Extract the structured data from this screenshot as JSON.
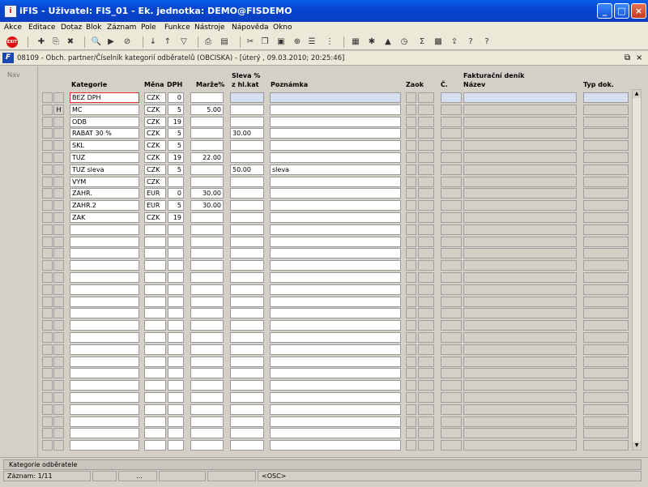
{
  "window": {
    "title": "iFIS - Uživatel: FIS_01 - Ek. jednotka: DEMO@FISDEMO",
    "app_icon_glyph": "i"
  },
  "menu": [
    "Akce",
    "Editace",
    "Dotaz",
    "Blok",
    "Záznam",
    "Pole",
    "Funkce",
    "Nástroje",
    "Nápověda",
    "Okno"
  ],
  "toolbar": {
    "exit_label": "EXIT",
    "icons": [
      {
        "name": "insert-record-icon",
        "glyph": "✚"
      },
      {
        "name": "save-record-icon",
        "glyph": "⎘"
      },
      {
        "name": "delete-record-icon",
        "glyph": "✖"
      },
      {
        "name": "enter-query-icon",
        "glyph": "🔍"
      },
      {
        "name": "execute-query-icon",
        "glyph": "▶"
      },
      {
        "name": "cancel-query-icon",
        "glyph": "⊘"
      },
      {
        "name": "sort-asc-icon",
        "glyph": "↓"
      },
      {
        "name": "sort-desc-icon",
        "glyph": "↑"
      },
      {
        "name": "filter-icon",
        "glyph": "▽"
      },
      {
        "name": "print-icon",
        "glyph": "⎙"
      },
      {
        "name": "print-preview-icon",
        "glyph": "▤"
      },
      {
        "name": "cut-icon",
        "glyph": "✂"
      },
      {
        "name": "copy-icon",
        "glyph": "❐"
      },
      {
        "name": "paste-icon",
        "glyph": "▣"
      },
      {
        "name": "zoom-icon",
        "glyph": "⊕"
      },
      {
        "name": "list-icon",
        "glyph": "☰"
      },
      {
        "name": "columns-icon",
        "glyph": "⋮"
      },
      {
        "name": "calculator-icon",
        "glyph": "▦"
      },
      {
        "name": "settings-icon",
        "glyph": "✱"
      },
      {
        "name": "triangle-icon",
        "glyph": "▲"
      },
      {
        "name": "clock-icon",
        "glyph": "◷"
      },
      {
        "name": "sum-icon",
        "glyph": "Σ"
      },
      {
        "name": "excel-icon",
        "glyph": "▩"
      },
      {
        "name": "export-icon",
        "glyph": "⇪"
      },
      {
        "name": "help-context-icon",
        "glyph": "?"
      },
      {
        "name": "help-icon",
        "glyph": "?"
      }
    ]
  },
  "form": {
    "icon_glyph": "F",
    "title": "08109 - Obch. partner/Číselník kategorií odběratelů (OBCISKA) - [úterý , 09.03.2010; 20:25:46]",
    "nav_label": "Nav"
  },
  "columns": {
    "kategorie": "Kategorie",
    "mena": "Měna",
    "dph": "DPH",
    "marze": "Marže%",
    "sleva_top": "Sleva %",
    "sleva_bottom": "z hl.kat",
    "poznamka": "Poznámka",
    "zaok": "Zaok",
    "cislo": "Č.",
    "fakt_top": "Fakturační deník",
    "fakt_bottom": "Název",
    "typ": "Typ dok."
  },
  "rows": [
    {
      "flag": "",
      "kategorie": "BEZ DPH",
      "mena": "CZK",
      "dph": "0",
      "marze": "",
      "sleva": "",
      "poznamka": ""
    },
    {
      "flag": "H",
      "kategorie": "MC",
      "mena": "CZK",
      "dph": "5",
      "marze": "5.00",
      "sleva": "",
      "poznamka": ""
    },
    {
      "flag": "",
      "kategorie": "ODB",
      "mena": "CZK",
      "dph": "19",
      "marze": "",
      "sleva": "",
      "poznamka": ""
    },
    {
      "flag": "",
      "kategorie": "RABAT 30 %",
      "mena": "CZK",
      "dph": "5",
      "marze": "",
      "sleva": "30.00",
      "poznamka": ""
    },
    {
      "flag": "",
      "kategorie": "SKL",
      "mena": "CZK",
      "dph": "5",
      "marze": "",
      "sleva": "",
      "poznamka": ""
    },
    {
      "flag": "",
      "kategorie": "TUZ",
      "mena": "CZK",
      "dph": "19",
      "marze": "22.00",
      "sleva": "",
      "poznamka": ""
    },
    {
      "flag": "",
      "kategorie": "TUZ sleva",
      "mena": "CZK",
      "dph": "5",
      "marze": "",
      "sleva": "50.00",
      "poznamka": "sleva"
    },
    {
      "flag": "",
      "kategorie": "VYM",
      "mena": "CZK",
      "dph": "",
      "marze": "",
      "sleva": "",
      "poznamka": ""
    },
    {
      "flag": "",
      "kategorie": "ZAHR.",
      "mena": "EUR",
      "dph": "0",
      "marze": "30.00",
      "sleva": "",
      "poznamka": ""
    },
    {
      "flag": "",
      "kategorie": "ZAHR.2",
      "mena": "EUR",
      "dph": "5",
      "marze": "30.00",
      "sleva": "",
      "poznamka": ""
    },
    {
      "flag": "",
      "kategorie": "ZAK",
      "mena": "CZK",
      "dph": "19",
      "marze": "",
      "sleva": "",
      "poznamka": ""
    }
  ],
  "status": {
    "message": "Kategorie odběratele",
    "record": "Záznam: 1/11",
    "ellipsis": "...",
    "mode": "<OSC>"
  }
}
